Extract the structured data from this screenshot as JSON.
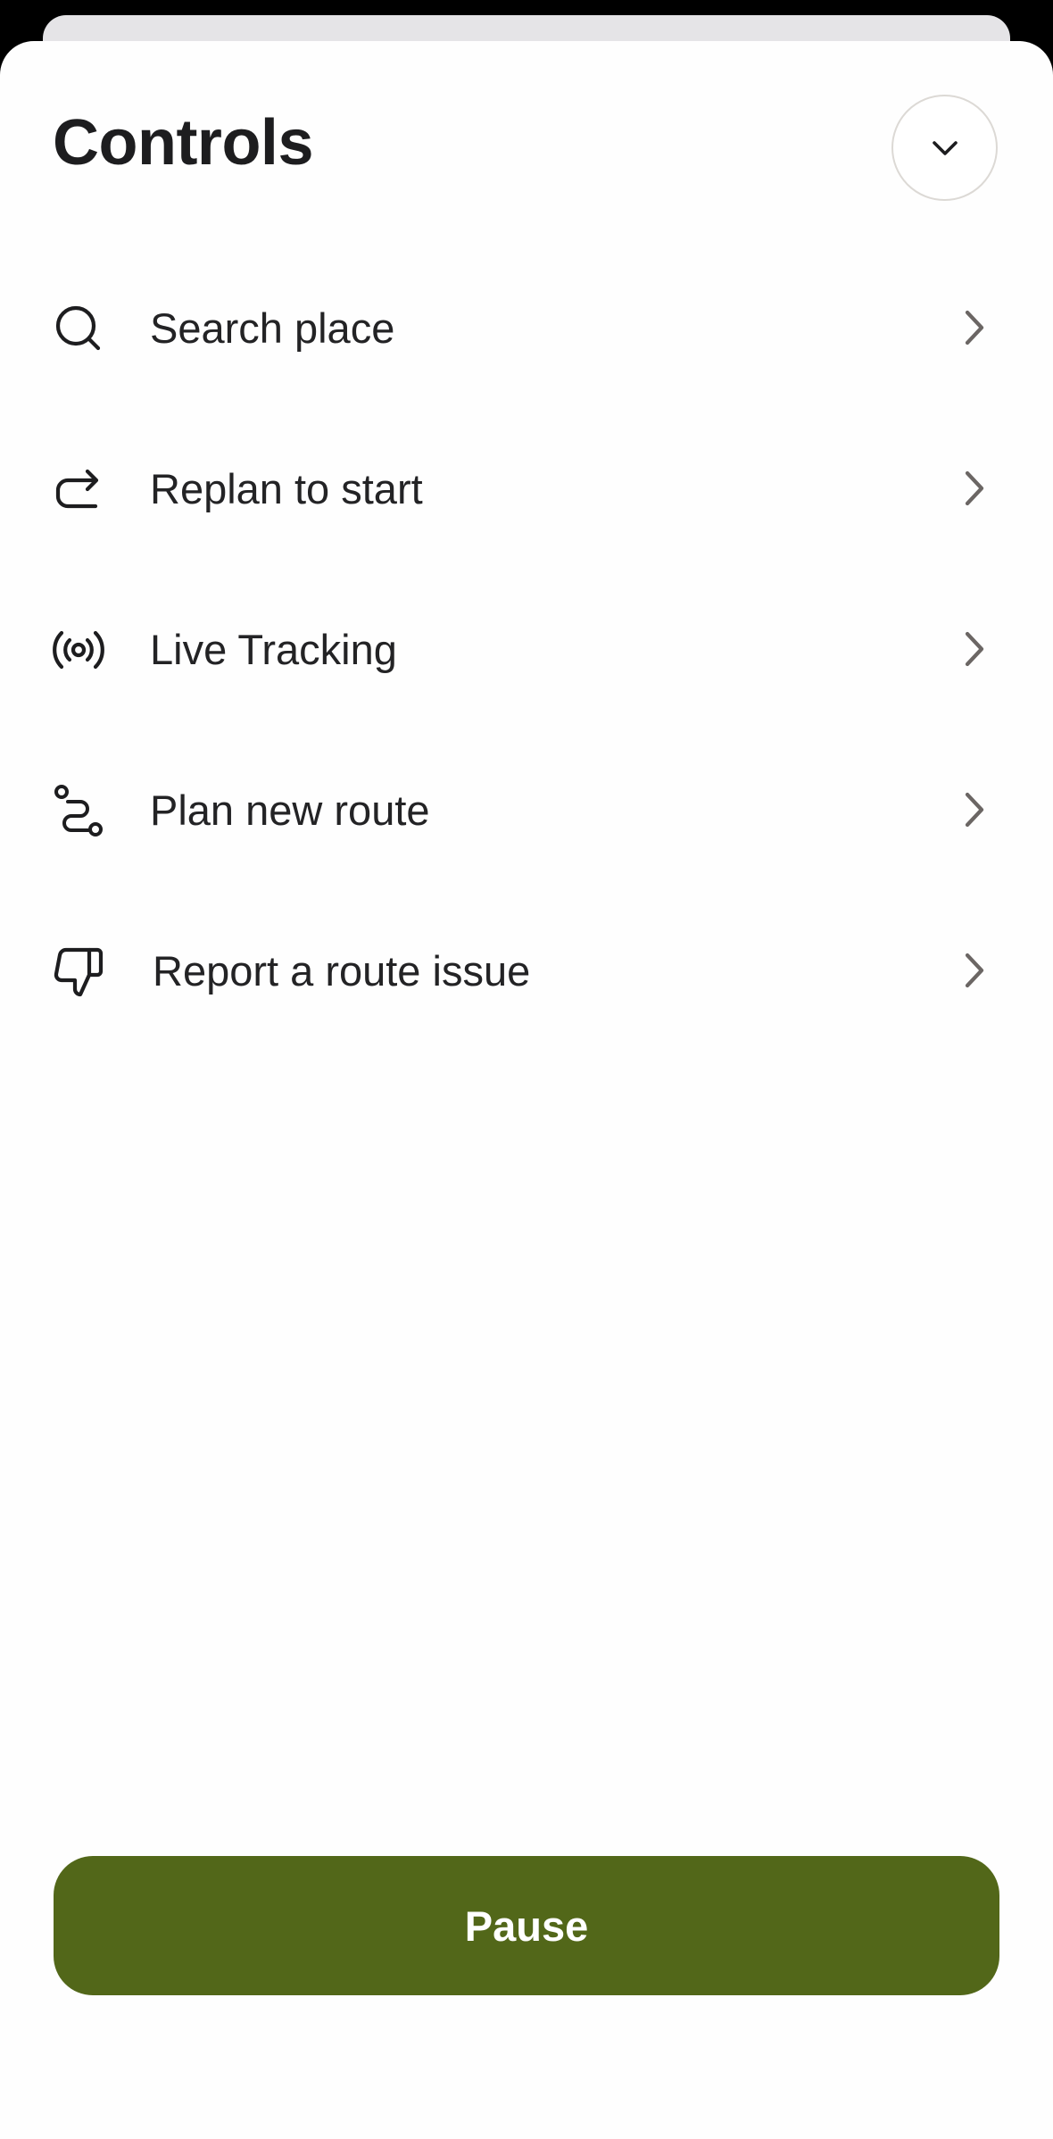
{
  "sheet": {
    "title": "Controls",
    "collapse_icon": "chevron-down-icon"
  },
  "menu": {
    "items": [
      {
        "label": "Search place",
        "icon": "search-icon"
      },
      {
        "label": "Replan to start",
        "icon": "replan-icon"
      },
      {
        "label": "Live Tracking",
        "icon": "broadcast-icon"
      },
      {
        "label": "Plan new route",
        "icon": "route-icon"
      },
      {
        "label": "Report a route issue",
        "icon": "thumbs-down-icon"
      }
    ],
    "chevron_icon": "chevron-right-icon"
  },
  "primary_action": {
    "label": "Pause"
  },
  "colors": {
    "accent": "#526719",
    "text": "#1d1d1f",
    "chevron": "#6b6664",
    "background": "#fefefe"
  }
}
